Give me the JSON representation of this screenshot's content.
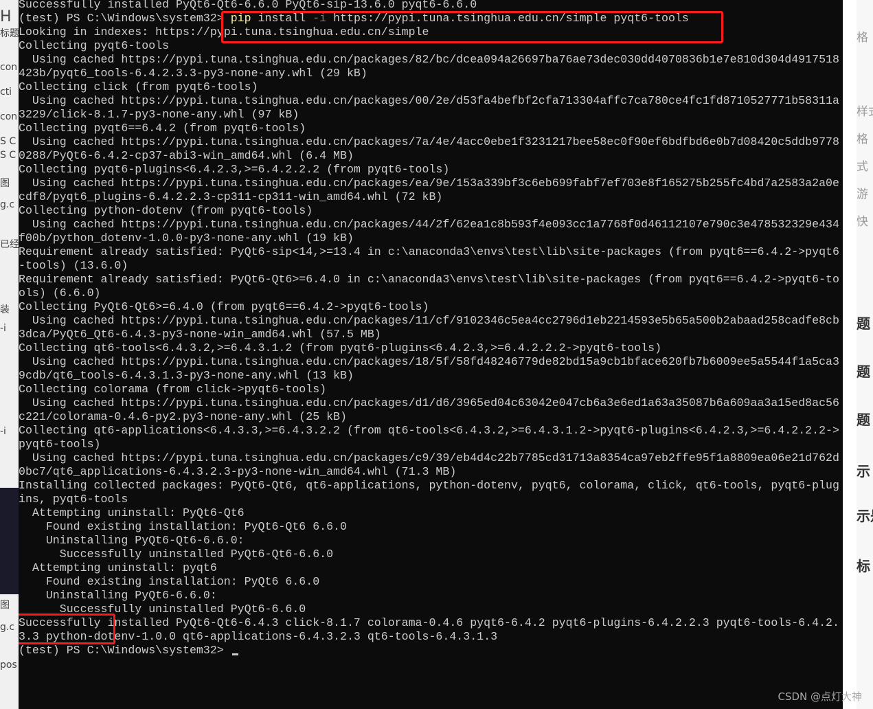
{
  "terminal": {
    "lines": [
      "Successfully installed PyQt6-Qt6-6.6.0 PyQt6-sip-13.6.0 pyqt6-6.6.0",
      "__PROMPT__",
      "Looking in indexes: https://pypi.tuna.tsinghua.edu.cn/simple",
      "Collecting pyqt6-tools",
      "  Using cached https://pypi.tuna.tsinghua.edu.cn/packages/82/bc/dcea094a26697ba76ae73dec030dd4070836b1e7e810d304d4917518",
      "423b/pyqt6_tools-6.4.2.3.3-py3-none-any.whl (29 kB)",
      "Collecting click (from pyqt6-tools)",
      "  Using cached https://pypi.tuna.tsinghua.edu.cn/packages/00/2e/d53fa4befbf2cfa713304affc7ca780ce4fc1fd8710527771b58311a",
      "3229/click-8.1.7-py3-none-any.whl (97 kB)",
      "Collecting pyqt6==6.4.2 (from pyqt6-tools)",
      "  Using cached https://pypi.tuna.tsinghua.edu.cn/packages/7a/4e/4acc0ebe1f3231217bee58ec0f90ef6bdfbd6e0b7d08420c5ddb9778",
      "0288/PyQt6-6.4.2-cp37-abi3-win_amd64.whl (6.4 MB)",
      "Collecting pyqt6-plugins<6.4.2.3,>=6.4.2.2.2 (from pyqt6-tools)",
      "  Using cached https://pypi.tuna.tsinghua.edu.cn/packages/ea/9e/153a339bf3c6eb699fabf7ef703e8f165275b255fc4bd7a2583a2a0e",
      "cdf8/pyqt6_plugins-6.4.2.2.3-cp311-cp311-win_amd64.whl (72 kB)",
      "Collecting python-dotenv (from pyqt6-tools)",
      "  Using cached https://pypi.tuna.tsinghua.edu.cn/packages/44/2f/62ea1c8b593f4e093cc1a7768f0d46112107e790c3e478532329e434",
      "f00b/python_dotenv-1.0.0-py3-none-any.whl (19 kB)",
      "Requirement already satisfied: PyQt6-sip<14,>=13.4 in c:\\anaconda3\\envs\\test\\lib\\site-packages (from pyqt6==6.4.2->pyqt6",
      "-tools) (13.6.0)",
      "Requirement already satisfied: PyQt6-Qt6>=6.4.0 in c:\\anaconda3\\envs\\test\\lib\\site-packages (from pyqt6==6.4.2->pyqt6-to",
      "ols) (6.6.0)",
      "Collecting PyQt6-Qt6>=6.4.0 (from pyqt6==6.4.2->pyqt6-tools)",
      "  Using cached https://pypi.tuna.tsinghua.edu.cn/packages/11/cf/9102346c5ea4cc2796d1eb2214593e5b65a500b2abaad258cadfe8cb",
      "3dca/PyQt6_Qt6-6.4.3-py3-none-win_amd64.whl (57.5 MB)",
      "Collecting qt6-tools<6.4.3.2,>=6.4.3.1.2 (from pyqt6-plugins<6.4.2.3,>=6.4.2.2.2->pyqt6-tools)",
      "  Using cached https://pypi.tuna.tsinghua.edu.cn/packages/18/5f/58fd48246779de82bd15a9cb1bface620fb7b6009ee5a5544f1a5ca3",
      "9cdb/qt6_tools-6.4.3.1.3-py3-none-any.whl (13 kB)",
      "Collecting colorama (from click->pyqt6-tools)",
      "  Using cached https://pypi.tuna.tsinghua.edu.cn/packages/d1/d6/3965ed04c63042e047cb6a3e6ed1a63a35087b6a609aa3a15ed8ac56",
      "c221/colorama-0.4.6-py2.py3-none-any.whl (25 kB)",
      "Collecting qt6-applications<6.4.3.3,>=6.4.3.2.2 (from qt6-tools<6.4.3.2,>=6.4.3.1.2->pyqt6-plugins<6.4.2.3,>=6.4.2.2.2->",
      "pyqt6-tools)",
      "  Using cached https://pypi.tuna.tsinghua.edu.cn/packages/c9/39/eb4d4c22b7785cd31713a8354ca97eb2ffe95f1a8809ea06e21d762d",
      "0bc7/qt6_applications-6.4.3.2.3-py3-none-win_amd64.whl (71.3 MB)",
      "Installing collected packages: PyQt6-Qt6, qt6-applications, python-dotenv, pyqt6, colorama, click, qt6-tools, pyqt6-plug",
      "ins, pyqt6-tools",
      "  Attempting uninstall: PyQt6-Qt6",
      "    Found existing installation: PyQt6-Qt6 6.6.0",
      "    Uninstalling PyQt6-Qt6-6.6.0:",
      "      Successfully uninstalled PyQt6-Qt6-6.6.0",
      "  Attempting uninstall: pyqt6",
      "    Found existing installation: PyQt6 6.6.0",
      "    Uninstalling PyQt6-6.6.0:",
      "      Successfully uninstalled PyQt6-6.6.0",
      "Successfully installed PyQt6-Qt6-6.4.3 click-8.1.7 colorama-0.4.6 pyqt6-6.4.2 pyqt6-plugins-6.4.2.2.3 pyqt6-tools-6.4.2.",
      "3.3 python-dotenv-1.0.0 qt6-applications-6.4.3.2.3 qt6-tools-6.4.3.1.3",
      "__FINAL__"
    ],
    "prompt": "(test) PS C:\\Windows\\system32> ",
    "command": {
      "program": "pip",
      "args1": " install ",
      "flag": "-i",
      "args2": " https://pypi.tuna.tsinghua.edu.cn/simple pyqt6-tools"
    },
    "final_prompt": "(test) PS C:\\Windows\\system32> "
  },
  "left_fragments": [
    "H",
    "标题",
    "con",
    "cti",
    "con",
    "S C",
    "S C",
    "图",
    "g.c",
    "已经",
    "装",
    "-i",
    "-i",
    "图",
    "g.c",
    "pos"
  ],
  "right_fragments": [
    "格",
    "样式",
    "格",
    "式",
    "游",
    "快",
    "题",
    "题",
    "题",
    "示",
    "示是",
    "标"
  ],
  "watermark": "CSDN @点灯大神",
  "colors": {
    "terminal_bg": "#0c0c0c",
    "text": "#cccccc",
    "command": "#f9f1a5",
    "flag": "#767676",
    "highlight_box": "#ff1a1a"
  }
}
